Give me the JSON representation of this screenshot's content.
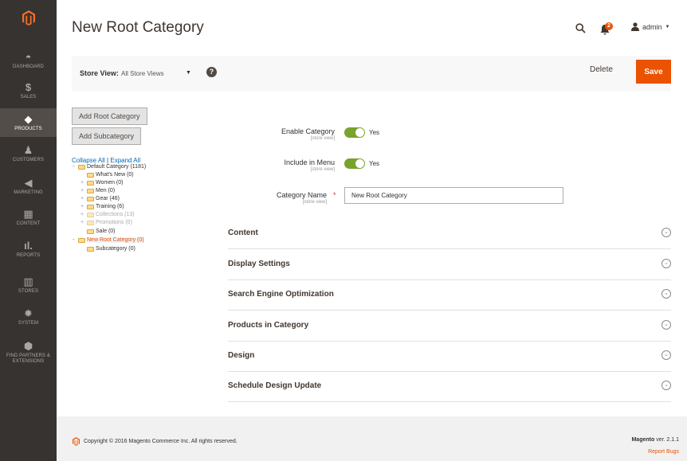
{
  "sidebar": {
    "items": [
      {
        "label": "Dashboard",
        "icon": "dashboard-icon"
      },
      {
        "label": "Sales",
        "icon": "dollar-icon"
      },
      {
        "label": "Products",
        "icon": "cube-icon",
        "active": true
      },
      {
        "label": "Customers",
        "icon": "person-icon"
      },
      {
        "label": "Marketing",
        "icon": "megaphone-icon"
      },
      {
        "label": "Content",
        "icon": "layout-icon"
      },
      {
        "label": "Reports",
        "icon": "bar-chart-icon"
      },
      {
        "label": "Stores",
        "icon": "storefront-icon"
      },
      {
        "label": "System",
        "icon": "gear-icon"
      },
      {
        "label": "Find Partners & Extensions",
        "icon": "partners-icon"
      }
    ]
  },
  "header": {
    "title": "New Root Category",
    "notifications_count": "2",
    "admin_label": "admin"
  },
  "actionbar": {
    "store_view_label": "Store View:",
    "store_view_value": "All Store Views",
    "delete_label": "Delete",
    "save_label": "Save"
  },
  "left": {
    "add_root_label": "Add Root Category",
    "add_sub_label": "Add Subcategory",
    "collapse_all": "Collapse All",
    "separator": "|",
    "expand_all": "Expand All",
    "tree": [
      {
        "label": "Default Category (1181)"
      },
      {
        "label": "What's New (0)"
      },
      {
        "label": "Women (0)"
      },
      {
        "label": "Men (0)"
      },
      {
        "label": "Gear (46)"
      },
      {
        "label": "Training (6)"
      },
      {
        "label": "Collections (13)"
      },
      {
        "label": "Promotions (0)"
      },
      {
        "label": "Sale (0)"
      },
      {
        "label": "New Root Category (0)"
      },
      {
        "label": "Subcategory (0)"
      }
    ]
  },
  "form": {
    "enable_label": "Enable Category",
    "enable_scope": "[store view]",
    "enable_value": "Yes",
    "menu_label": "Include in Menu",
    "menu_scope": "[store view]",
    "menu_value": "Yes",
    "name_label": "Category Name",
    "name_scope": "[store view]",
    "name_value": "New Root Category"
  },
  "sections": [
    {
      "title": "Content"
    },
    {
      "title": "Display Settings"
    },
    {
      "title": "Search Engine Optimization"
    },
    {
      "title": "Products in Category"
    },
    {
      "title": "Design"
    },
    {
      "title": "Schedule Design Update"
    }
  ],
  "footer": {
    "copyright": "Copyright © 2016 Magento Commerce Inc. All rights reserved.",
    "brand": "Magento",
    "version": "ver. 2.1.1",
    "report_bugs": "Report Bugs"
  },
  "colors": {
    "accent": "#eb5202",
    "sidebar": "#373330",
    "toggle_on": "#79a22e",
    "link": "#006bb4"
  }
}
